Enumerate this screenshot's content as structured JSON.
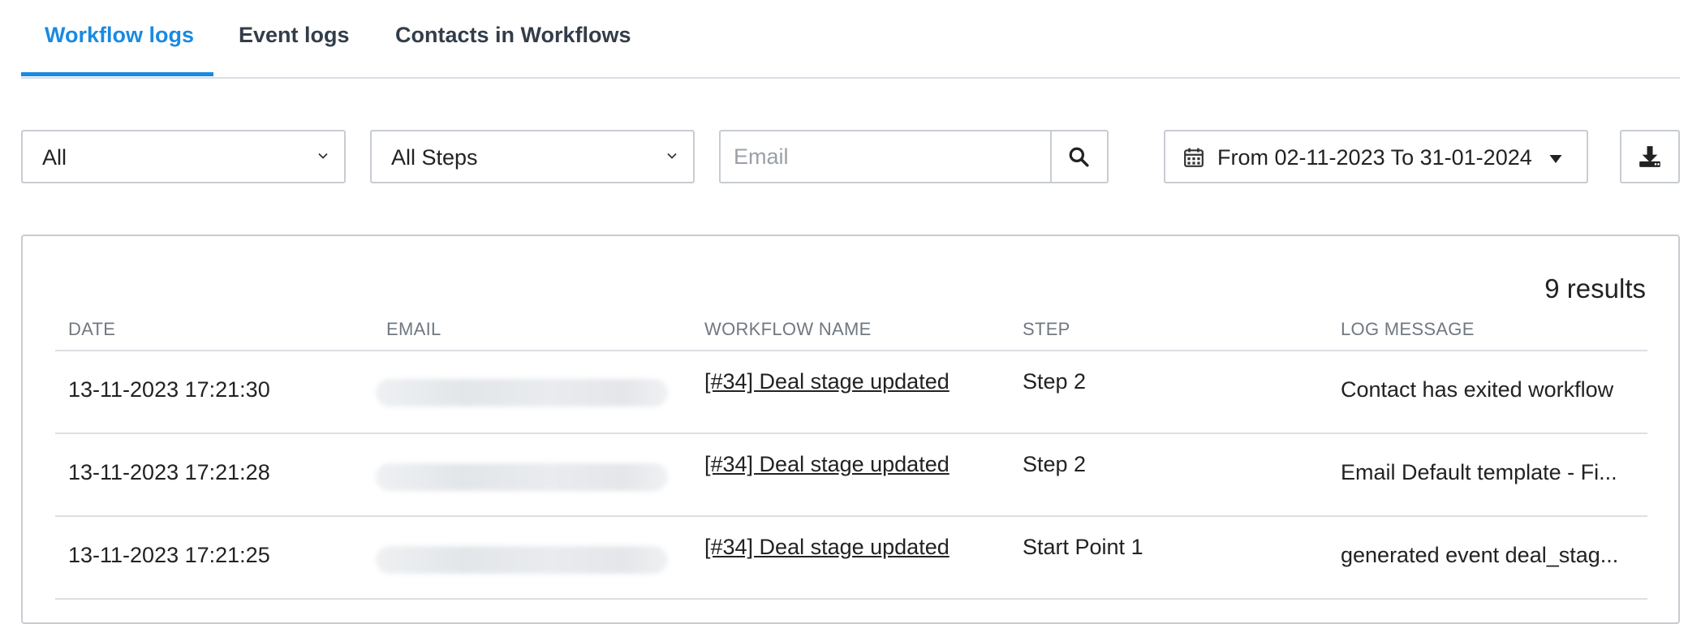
{
  "tabs": [
    {
      "label": "Workflow logs",
      "active": true
    },
    {
      "label": "Event logs",
      "active": false
    },
    {
      "label": "Contacts in Workflows",
      "active": false
    }
  ],
  "filters": {
    "status_select": "All",
    "steps_select": "All Steps",
    "email_placeholder": "Email",
    "date_range": "From 02-11-2023 To 31-01-2024"
  },
  "results_label": "9 results",
  "table": {
    "columns": [
      "DATE",
      "EMAIL",
      "WORKFLOW NAME",
      "STEP",
      "LOG MESSAGE"
    ],
    "rows": [
      {
        "date": "13-11-2023 17:21:30",
        "workflow": "[#34] Deal stage updated",
        "step": "Step 2",
        "message": "Contact has exited workflow"
      },
      {
        "date": "13-11-2023 17:21:28",
        "workflow": "[#34] Deal stage updated",
        "step": "Step 2",
        "message": "Email Default template - Fi..."
      },
      {
        "date": "13-11-2023 17:21:25",
        "workflow": "[#34] Deal stage updated",
        "step": "Start Point 1",
        "message": "generated event deal_stag..."
      }
    ]
  },
  "icons": {
    "select_chevron": "chevron-down-icon",
    "search": "search-icon",
    "calendar": "calendar-icon",
    "date_caret": "caret-down-icon",
    "download": "download-icon"
  },
  "colors": {
    "accent": "#1a8ae0",
    "border": "#c8ccd2",
    "header_text": "#707880"
  }
}
